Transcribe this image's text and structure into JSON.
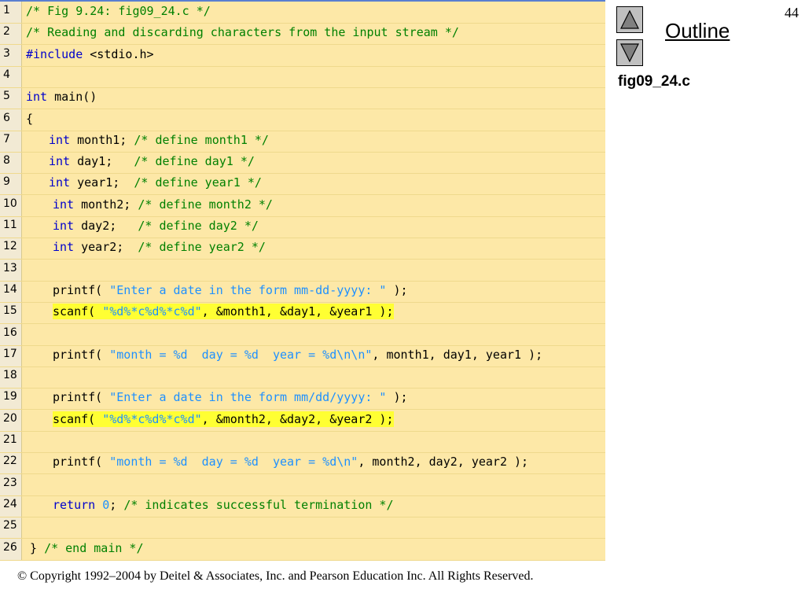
{
  "slide": {
    "page_number": "44",
    "outline_label": "Outline",
    "filename": "fig09_24.c",
    "copyright": "© Copyright 1992–2004 by Deitel & Associates, Inc. and Pearson Education Inc. All Rights Reserved.",
    "nav": {
      "up_icon": "triangle-up-icon",
      "down_icon": "triangle-down-icon"
    }
  },
  "colors": {
    "code_bg": "#fde8a7",
    "highlight": "#ffff33",
    "comment": "#008000",
    "keyword": "#0000cc",
    "string": "#1e90ff"
  },
  "code": {
    "lines": [
      {
        "num": "1",
        "indent": "",
        "segments": [
          {
            "t": "/* Fig 9.24: fig09_24.c */",
            "c": "cm"
          }
        ]
      },
      {
        "num": "2",
        "indent": "",
        "segments": [
          {
            "t": "/* Reading and discarding characters from the input stream */",
            "c": "cm"
          }
        ]
      },
      {
        "num": "3",
        "indent": "",
        "segments": [
          {
            "t": "#include",
            "c": "pp"
          },
          {
            "t": " <stdio.h>",
            "c": ""
          }
        ]
      },
      {
        "num": "4",
        "indent": "",
        "segments": []
      },
      {
        "num": "5",
        "indent": "",
        "segments": [
          {
            "t": "int",
            "c": "kw"
          },
          {
            "t": " main()",
            "c": ""
          }
        ]
      },
      {
        "num": "6",
        "indent": "",
        "segments": [
          {
            "t": "{",
            "c": ""
          }
        ]
      },
      {
        "num": "7",
        "indent": "sm",
        "segments": [
          {
            "t": "int",
            "c": "kw"
          },
          {
            "t": " month1; ",
            "c": ""
          },
          {
            "t": "/* define month1 */",
            "c": "cm"
          }
        ]
      },
      {
        "num": "8",
        "indent": "sm",
        "segments": [
          {
            "t": "int",
            "c": "kw"
          },
          {
            "t": " day1;   ",
            "c": ""
          },
          {
            "t": "/* define day1 */",
            "c": "cm"
          }
        ]
      },
      {
        "num": "9",
        "indent": "sm",
        "segments": [
          {
            "t": "int",
            "c": "kw"
          },
          {
            "t": " year1;  ",
            "c": ""
          },
          {
            "t": "/* define year1 */",
            "c": "cm"
          }
        ]
      },
      {
        "num": "10",
        "indent": "md",
        "segments": [
          {
            "t": "int",
            "c": "kw"
          },
          {
            "t": " month2; ",
            "c": ""
          },
          {
            "t": "/* define month2 */",
            "c": "cm"
          }
        ]
      },
      {
        "num": "11",
        "indent": "md",
        "segments": [
          {
            "t": "int",
            "c": "kw"
          },
          {
            "t": " day2;   ",
            "c": ""
          },
          {
            "t": "/* define day2 */",
            "c": "cm"
          }
        ]
      },
      {
        "num": "12",
        "indent": "md",
        "segments": [
          {
            "t": "int",
            "c": "kw"
          },
          {
            "t": " year2;  ",
            "c": ""
          },
          {
            "t": "/* define year2 */",
            "c": "cm"
          }
        ]
      },
      {
        "num": "13",
        "indent": "",
        "segments": []
      },
      {
        "num": "14",
        "indent": "md",
        "segments": [
          {
            "t": "printf( ",
            "c": ""
          },
          {
            "t": "\"Enter a date in the form mm-dd-yyyy: \"",
            "c": "st"
          },
          {
            "t": " );",
            "c": ""
          }
        ]
      },
      {
        "num": "15",
        "indent": "md",
        "highlight": true,
        "segments": [
          {
            "t": "scanf( ",
            "c": ""
          },
          {
            "t": "\"%d%*c%d%*c%d\"",
            "c": "st"
          },
          {
            "t": ", &month1, &day1, &year1 );",
            "c": ""
          }
        ]
      },
      {
        "num": "16",
        "indent": "",
        "segments": []
      },
      {
        "num": "17",
        "indent": "md",
        "segments": [
          {
            "t": "printf( ",
            "c": ""
          },
          {
            "t": "\"month = %d  day = %d  year = %d\\n\\n\"",
            "c": "st"
          },
          {
            "t": ", month1, day1, year1 );",
            "c": ""
          }
        ]
      },
      {
        "num": "18",
        "indent": "",
        "segments": []
      },
      {
        "num": "19",
        "indent": "md",
        "segments": [
          {
            "t": "printf( ",
            "c": ""
          },
          {
            "t": "\"Enter a date in the form mm/dd/yyyy: \"",
            "c": "st"
          },
          {
            "t": " );",
            "c": ""
          }
        ]
      },
      {
        "num": "20",
        "indent": "md",
        "highlight": true,
        "segments": [
          {
            "t": "scanf( ",
            "c": ""
          },
          {
            "t": "\"%d%*c%d%*c%d\"",
            "c": "st"
          },
          {
            "t": ", &month2, &day2, &year2 );",
            "c": ""
          }
        ]
      },
      {
        "num": "21",
        "indent": "",
        "segments": []
      },
      {
        "num": "22",
        "indent": "md",
        "segments": [
          {
            "t": "printf( ",
            "c": ""
          },
          {
            "t": "\"month = %d  day = %d  year = %d\\n\"",
            "c": "st"
          },
          {
            "t": ", month2, day2, year2 );",
            "c": ""
          }
        ]
      },
      {
        "num": "23",
        "indent": "",
        "segments": []
      },
      {
        "num": "24",
        "indent": "md",
        "segments": [
          {
            "t": "return",
            "c": "kw"
          },
          {
            "t": " ",
            "c": ""
          },
          {
            "t": "0",
            "c": "nm"
          },
          {
            "t": "; ",
            "c": ""
          },
          {
            "t": "/* indicates successful termination */",
            "c": "cm"
          }
        ]
      },
      {
        "num": "25",
        "indent": "",
        "segments": []
      },
      {
        "num": "26",
        "indent": "ed",
        "segments": [
          {
            "t": "} ",
            "c": ""
          },
          {
            "t": "/* end main */",
            "c": "cm"
          }
        ]
      }
    ]
  }
}
